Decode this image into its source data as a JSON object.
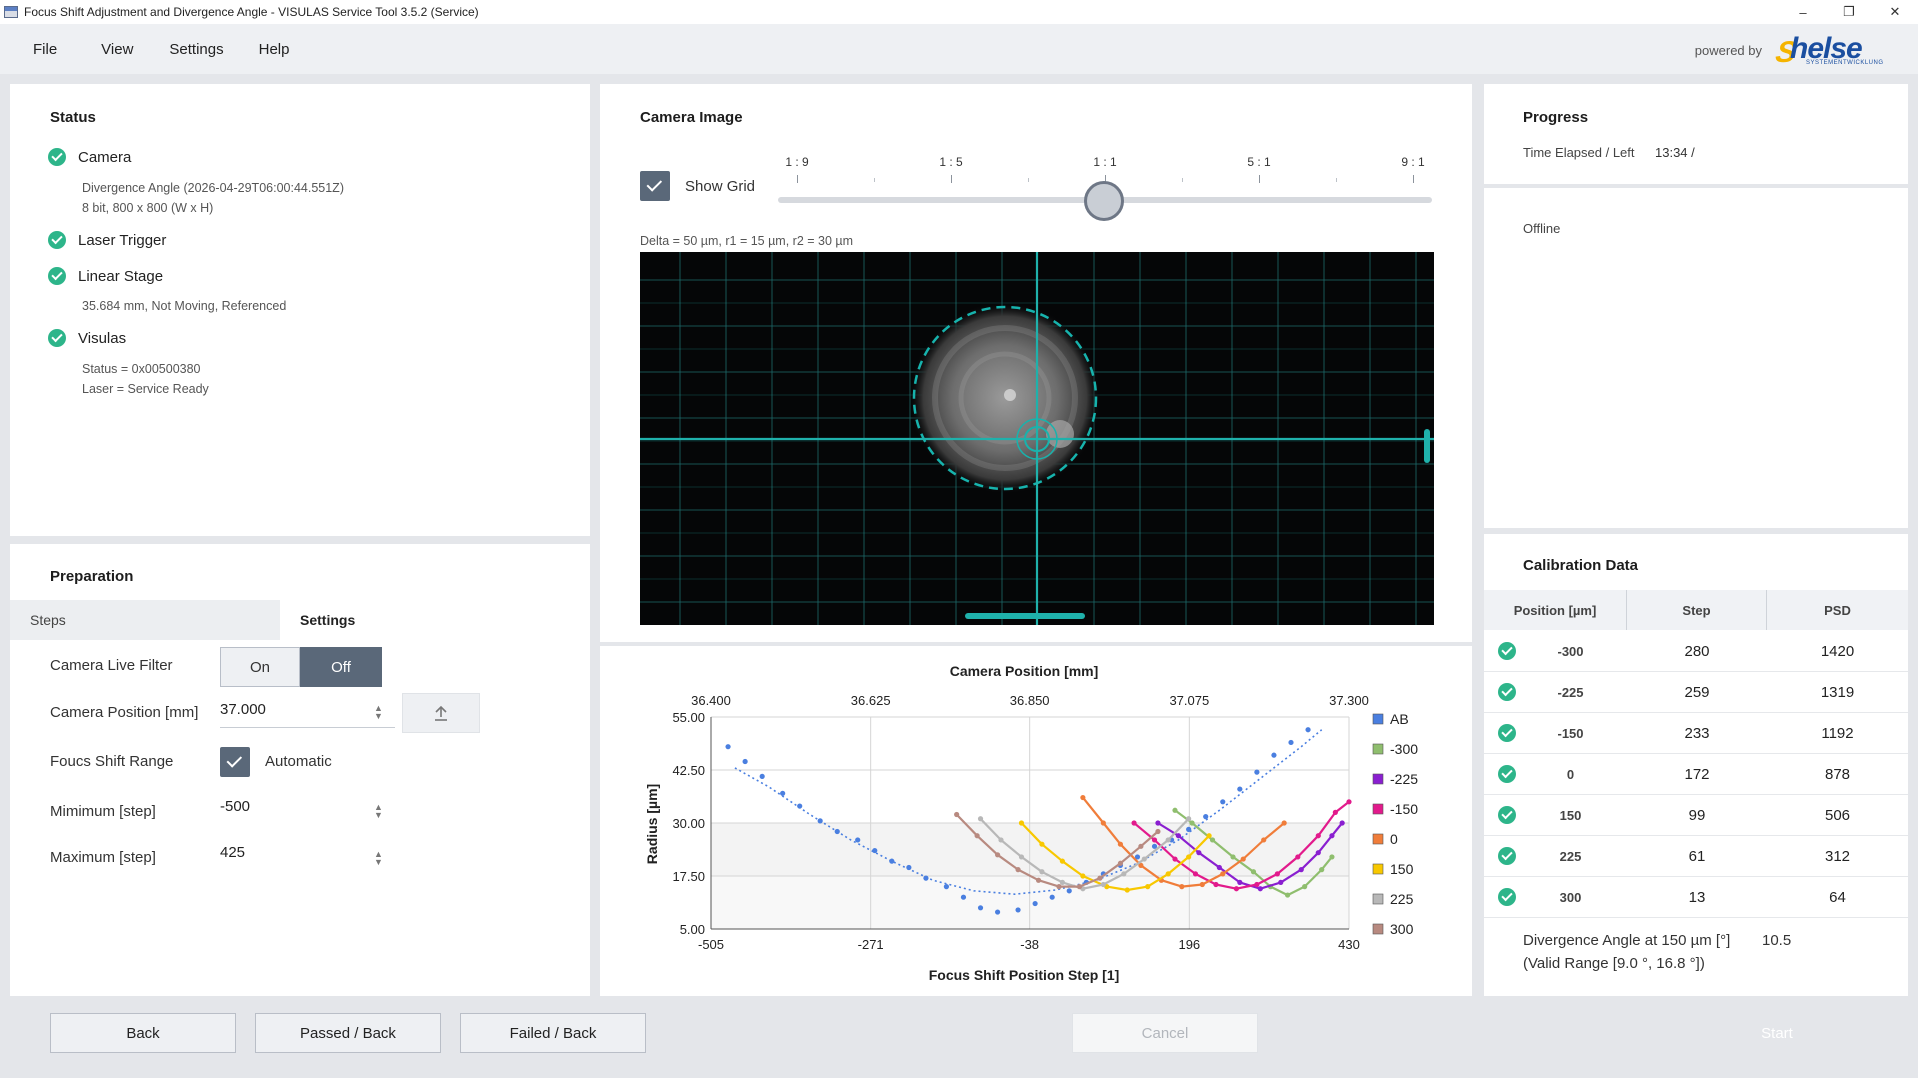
{
  "window": {
    "title": "Focus Shift Adjustment and Divergence Angle - VISULAS Service Tool 3.5.2 (Service)",
    "minimize": "–",
    "maximize": "❐",
    "close": "✕"
  },
  "menu": [
    "File",
    "View",
    "Settings",
    "Help"
  ],
  "branding": {
    "powered_by": "powered by",
    "logo_text": "helse",
    "logo_sub": "SYSTEMENTWICKLUNG"
  },
  "status": {
    "title": "Status",
    "items": [
      {
        "label": "Camera",
        "details": [
          "Divergence Angle (2026-04-29T06:00:44.551Z)",
          "8 bit, 800 x 800 (W x H)"
        ]
      },
      {
        "label": "Laser Trigger",
        "details": []
      },
      {
        "label": "Linear Stage",
        "details": [
          "35.684 mm, Not Moving, Referenced"
        ]
      },
      {
        "label": "Visulas",
        "details": [
          "Status = 0x00500380",
          "Laser = Service Ready"
        ]
      }
    ]
  },
  "preparation": {
    "title": "Preparation",
    "tabs": [
      "Steps",
      "Settings"
    ],
    "active_tab": "Settings",
    "camera_live_filter": {
      "label": "Camera Live Filter",
      "on": "On",
      "off": "Off",
      "selected": "Off"
    },
    "camera_position": {
      "label": "Camera Position [mm]",
      "value": "37.000"
    },
    "focus_shift_range": {
      "label": "Foucs Shift Range",
      "checkbox_label": "Automatic",
      "checked": true
    },
    "minimum": {
      "label": "Mimimum [step]",
      "value": "-500"
    },
    "maximum": {
      "label": "Maximum [step]",
      "value": "425"
    }
  },
  "camera_image": {
    "title": "Camera Image",
    "show_grid": {
      "label": "Show Grid",
      "checked": true
    },
    "zoom_ticks": [
      "1 : 9",
      "1 : 5",
      "1 : 1",
      "5 : 1",
      "9 : 1"
    ],
    "zoom_value": "1 : 1",
    "caption": "Delta = 50 µm, r1 = 15 µm, r2 = 30 µm"
  },
  "progress": {
    "title": "Progress",
    "time_label": "Time Elapsed / Left",
    "time_value": "13:34 /",
    "status": "Offline"
  },
  "calibration": {
    "title": "Calibration Data",
    "columns": [
      "Position [µm]",
      "Step",
      "PSD"
    ],
    "rows": [
      {
        "position": "-300",
        "step": "280",
        "psd": "1420"
      },
      {
        "position": "-225",
        "step": "259",
        "psd": "1319"
      },
      {
        "position": "-150",
        "step": "233",
        "psd": "1192"
      },
      {
        "position": "0",
        "step": "172",
        "psd": "878"
      },
      {
        "position": "150",
        "step": "99",
        "psd": "506"
      },
      {
        "position": "225",
        "step": "61",
        "psd": "312"
      },
      {
        "position": "300",
        "step": "13",
        "psd": "64"
      }
    ],
    "divergence_line1_label": "Divergence Angle at 150 µm [°]",
    "divergence_value": "10.5",
    "divergence_line2": "(Valid Range [9.0 °, 16.8 °])"
  },
  "buttons": {
    "back": "Back",
    "passed_back": "Passed / Back",
    "failed_back": "Failed / Back",
    "cancel": "Cancel",
    "start": "Start"
  },
  "chart_data": {
    "type": "scatter",
    "title": "Camera Position [mm]",
    "xlabel": "Focus Shift Position Step [1]",
    "ylabel": "Radius [µm]",
    "xlim": [
      -505,
      430
    ],
    "ylim": [
      5,
      55
    ],
    "x_ticks": [
      "-505",
      "-271",
      "-38",
      "196",
      "430"
    ],
    "y_ticks": [
      "5.00",
      "17.50",
      "30.00",
      "42.50",
      "55.00"
    ],
    "top_ticks": [
      "36.400",
      "36.625",
      "36.850",
      "37.075",
      "37.300"
    ],
    "legend_position": "right",
    "series": [
      {
        "name": "AB",
        "color": "#4a7fe0",
        "dotted": true,
        "points": [
          [
            -480,
            48
          ],
          [
            -455,
            44.5
          ],
          [
            -430,
            41
          ],
          [
            -400,
            37
          ],
          [
            -375,
            34
          ],
          [
            -345,
            30.5
          ],
          [
            -320,
            28
          ],
          [
            -290,
            26
          ],
          [
            -265,
            23.5
          ],
          [
            -240,
            21
          ],
          [
            -215,
            19.5
          ],
          [
            -190,
            17
          ],
          [
            -160,
            15
          ],
          [
            -135,
            12.5
          ],
          [
            -110,
            10
          ],
          [
            -85,
            9
          ],
          [
            -55,
            9.5
          ],
          [
            -30,
            11
          ],
          [
            -5,
            12.5
          ],
          [
            20,
            14
          ],
          [
            45,
            16
          ],
          [
            70,
            18
          ],
          [
            95,
            20
          ],
          [
            120,
            22
          ],
          [
            145,
            24.5
          ],
          [
            170,
            26
          ],
          [
            195,
            28.5
          ],
          [
            220,
            31.5
          ],
          [
            245,
            35
          ],
          [
            270,
            38
          ],
          [
            295,
            42
          ],
          [
            320,
            46
          ],
          [
            345,
            49
          ],
          [
            370,
            52
          ]
        ],
        "fit": [
          [
            -470,
            43
          ],
          [
            -420,
            38.5
          ],
          [
            -360,
            32
          ],
          [
            -300,
            26
          ],
          [
            -240,
            21
          ],
          [
            -180,
            16.5
          ],
          [
            -120,
            14
          ],
          [
            -60,
            13.2
          ],
          [
            0,
            14.2
          ],
          [
            60,
            16.5
          ],
          [
            120,
            20.5
          ],
          [
            180,
            26
          ],
          [
            240,
            33
          ],
          [
            300,
            40.5
          ],
          [
            360,
            48
          ],
          [
            390,
            52
          ]
        ]
      },
      {
        "name": "-300",
        "color": "#8fbe6e",
        "points": [
          [
            175,
            33
          ],
          [
            200,
            30
          ],
          [
            230,
            26
          ],
          [
            260,
            22
          ],
          [
            290,
            18.5
          ],
          [
            315,
            15
          ],
          [
            340,
            13
          ],
          [
            365,
            15
          ],
          [
            390,
            19
          ],
          [
            405,
            22
          ]
        ]
      },
      {
        "name": "-225",
        "color": "#8a1fd0",
        "points": [
          [
            150,
            30
          ],
          [
            180,
            27
          ],
          [
            210,
            23
          ],
          [
            240,
            19.5
          ],
          [
            270,
            16
          ],
          [
            300,
            14.5
          ],
          [
            330,
            16
          ],
          [
            360,
            19
          ],
          [
            385,
            23
          ],
          [
            405,
            27
          ],
          [
            420,
            30
          ]
        ]
      },
      {
        "name": "-150",
        "color": "#e21a8c",
        "points": [
          [
            115,
            30
          ],
          [
            145,
            26
          ],
          [
            175,
            21.5
          ],
          [
            205,
            18
          ],
          [
            235,
            15.5
          ],
          [
            265,
            14.5
          ],
          [
            295,
            15.5
          ],
          [
            325,
            18
          ],
          [
            355,
            22
          ],
          [
            385,
            27
          ],
          [
            410,
            32.5
          ],
          [
            430,
            35
          ]
        ]
      },
      {
        "name": "0",
        "color": "#f07d3a",
        "points": [
          [
            40,
            36
          ],
          [
            70,
            30
          ],
          [
            95,
            25
          ],
          [
            125,
            20
          ],
          [
            155,
            16.5
          ],
          [
            185,
            15
          ],
          [
            215,
            15.5
          ],
          [
            245,
            18
          ],
          [
            275,
            21.5
          ],
          [
            305,
            26
          ],
          [
            335,
            30
          ]
        ]
      },
      {
        "name": "150",
        "color": "#f8c800",
        "points": [
          [
            -50,
            30
          ],
          [
            -20,
            25
          ],
          [
            10,
            21
          ],
          [
            40,
            17.5
          ],
          [
            75,
            15
          ],
          [
            105,
            14.2
          ],
          [
            135,
            15
          ],
          [
            165,
            18
          ],
          [
            195,
            22
          ],
          [
            225,
            27
          ]
        ]
      },
      {
        "name": "225",
        "color": "#b8b8b8",
        "points": [
          [
            -110,
            31
          ],
          [
            -80,
            26
          ],
          [
            -50,
            22
          ],
          [
            -20,
            18.5
          ],
          [
            10,
            16
          ],
          [
            40,
            14.5
          ],
          [
            70,
            15.5
          ],
          [
            100,
            18
          ],
          [
            130,
            21.5
          ],
          [
            165,
            26
          ],
          [
            195,
            31
          ]
        ]
      },
      {
        "name": "300",
        "color": "#b88a80",
        "points": [
          [
            -145,
            32
          ],
          [
            -115,
            27
          ],
          [
            -85,
            22.5
          ],
          [
            -55,
            19
          ],
          [
            -25,
            16.5
          ],
          [
            5,
            15
          ],
          [
            35,
            15
          ],
          [
            65,
            17
          ],
          [
            95,
            20.5
          ],
          [
            125,
            24.5
          ],
          [
            150,
            28
          ]
        ]
      }
    ]
  }
}
